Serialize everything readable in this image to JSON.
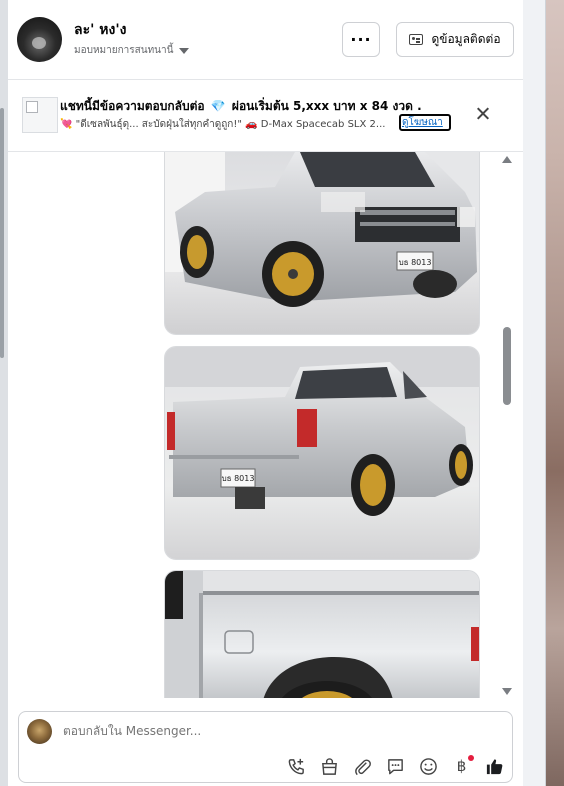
{
  "header": {
    "contact_name": "ละ' หง'ง",
    "assign_label": "มอบหมายการสนทนานี้",
    "more_label": "···",
    "contact_info_label": "ดูข้อมูลติดต่อ"
  },
  "notice": {
    "title_start": "แชทนี้มีข้อความตอบกลับต่อ",
    "gem": "💎",
    "title_end": "ผ่อนเริ่มต้น 5,xxx บาท x 84 งวด .",
    "sub_heart": "💘",
    "sub_text1": "\"ดีเซลพันธุ์ดุ... สะบัดฝุ่นใส่ทุกคำดูถูก!\"",
    "sub_car": "🚗",
    "sub_text2": "D-Max Spacecab SLX 2...",
    "ad_link": "ดูโฆษณา"
  },
  "messages": {
    "photos": [
      "pickup-front-view",
      "pickup-rear-view",
      "pickup-side-closeup"
    ],
    "plate_text": "บธ 8013"
  },
  "composer": {
    "placeholder": "ตอบกลับใน Messenger..."
  },
  "toolbar": {
    "icons": [
      "phone-add-icon",
      "shopping-bag-icon",
      "paperclip-icon",
      "chat-bubble-icon",
      "emoji-icon",
      "baht-icon",
      "like-icon"
    ],
    "baht_symbol": "฿"
  },
  "colors": {
    "accent": "#0a66c2",
    "badge": "#e41e3f",
    "text": "#050505",
    "muted": "#65676b"
  }
}
